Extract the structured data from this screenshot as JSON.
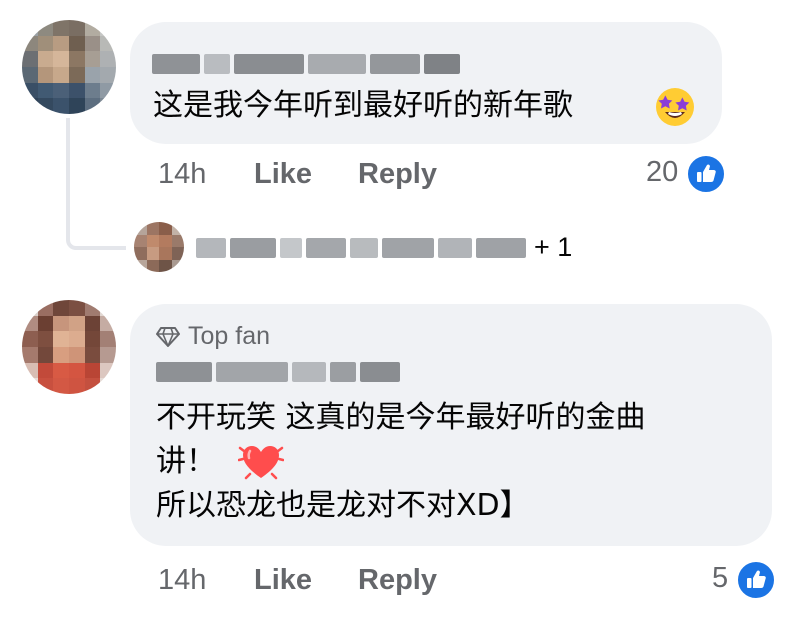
{
  "comments": [
    {
      "text_lines": [
        "这是我今年听到最好听的新年歌"
      ],
      "emoji": "star-struck-emoji",
      "time": "14h",
      "like_label": "Like",
      "reply_label": "Reply",
      "reaction_count": "20"
    },
    {
      "badge": "Top fan",
      "text_lines": [
        "不开玩笑 这真的是今年最好听的金曲",
        "讲！",
        "所以恐龙也是龙对不对XD】"
      ],
      "emoji": "beating-heart-emoji",
      "time": "14h",
      "like_label": "Like",
      "reply_label": "Reply",
      "reaction_count": "5"
    }
  ],
  "reply_summary": {
    "extra_count": "+ 1"
  },
  "colors": {
    "bubble": "#f0f2f5",
    "secondary_text": "#65676b",
    "like_blue": "#1b74e4"
  }
}
